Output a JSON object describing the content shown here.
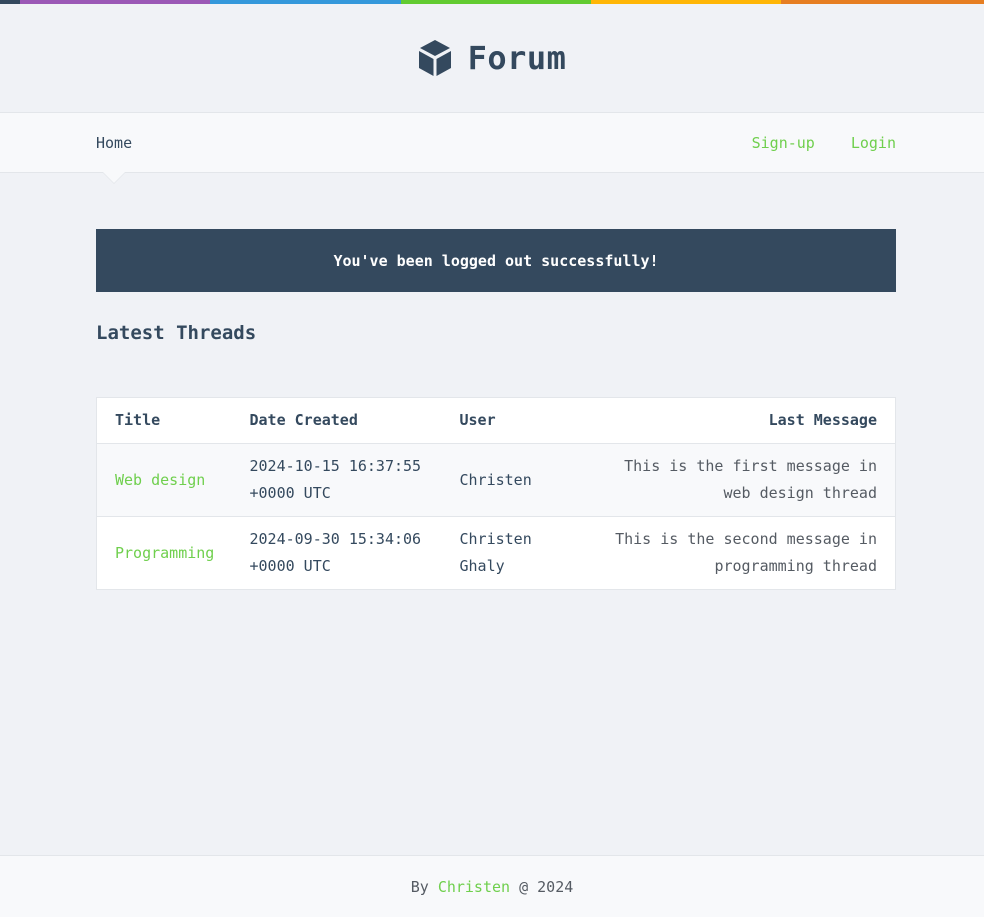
{
  "colors": {
    "bar": [
      "#34495e",
      "#9b59b6",
      "#3498db",
      "#62cb31",
      "#ffb606",
      "#e67e22"
    ],
    "accent": "#6fcf4d",
    "dark": "#34495e"
  },
  "header": {
    "logo_icon": "cube-icon",
    "title": "Forum"
  },
  "nav": {
    "home": "Home",
    "signup": "Sign-up",
    "login": "Login"
  },
  "alert": {
    "message": "You've been logged out successfully!"
  },
  "threads": {
    "heading": "Latest Threads",
    "columns": {
      "title": "Title",
      "date": "Date Created",
      "user": "User",
      "last": "Last Message"
    },
    "rows": [
      {
        "title": "Web design",
        "date_line1": "2024-10-15 16:37:55",
        "date_line2": "+0000 UTC",
        "user_line1": "Christen",
        "user_line2": "",
        "last_line1": "This is the first message in",
        "last_line2": "web design thread"
      },
      {
        "title": "Programming",
        "date_line1": "2024-09-30 15:34:06",
        "date_line2": "+0000 UTC",
        "user_line1": "Christen",
        "user_line2": "Ghaly",
        "last_line1": "This is the second message in",
        "last_line2": "programming thread"
      }
    ]
  },
  "footer": {
    "prefix": "By ",
    "author": "Christen",
    "suffix": " @ 2024"
  }
}
